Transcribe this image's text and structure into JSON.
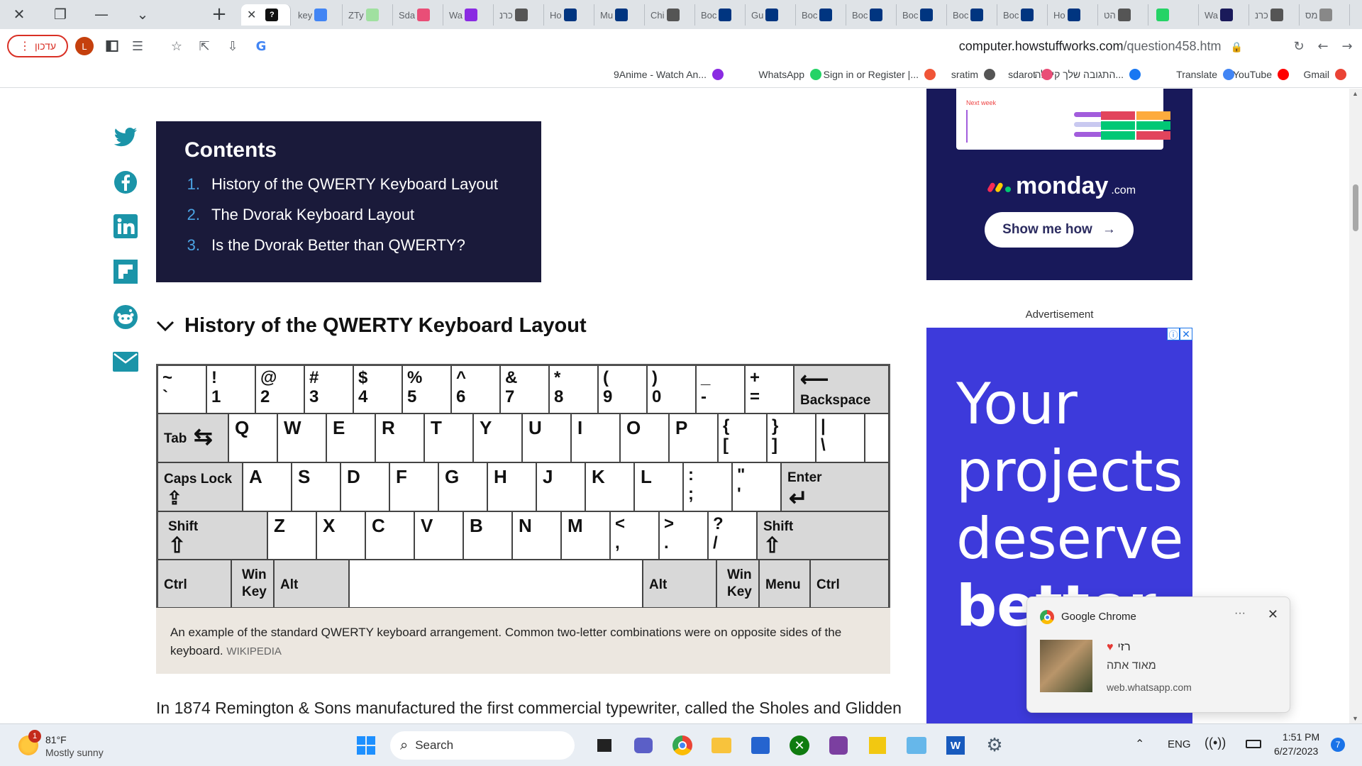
{
  "tabs": [
    {
      "label": "key",
      "icon": "docs-icon",
      "color": "#4285f4"
    },
    {
      "label": "ZTy",
      "icon": "zty-icon",
      "color": "#a0e0a0"
    },
    {
      "label": "Sda",
      "icon": "sdarot-icon",
      "color": "#e94e77"
    },
    {
      "label": "Wa",
      "icon": "play-icon",
      "color": "#8a2be2"
    },
    {
      "label": "כרנ",
      "icon": "globe-icon",
      "color": "#555555"
    },
    {
      "label": "Ho",
      "icon": "booking-icon",
      "color": "#003580"
    },
    {
      "label": "Mu",
      "icon": "booking-icon",
      "color": "#003580"
    },
    {
      "label": "Chi",
      "icon": "globe-icon",
      "color": "#555555"
    },
    {
      "label": "Boc",
      "icon": "booking-icon",
      "color": "#003580"
    },
    {
      "label": "Gu",
      "icon": "booking-icon",
      "color": "#003580"
    },
    {
      "label": "Boc",
      "icon": "booking-icon",
      "color": "#003580"
    },
    {
      "label": "Boc",
      "icon": "booking-icon",
      "color": "#003580"
    },
    {
      "label": "Boc",
      "icon": "booking-icon",
      "color": "#003580"
    },
    {
      "label": "Boc",
      "icon": "booking-icon",
      "color": "#003580"
    },
    {
      "label": "Boc",
      "icon": "booking-icon",
      "color": "#003580"
    },
    {
      "label": "Ho",
      "icon": "booking-icon",
      "color": "#003580"
    },
    {
      "label": "הט",
      "icon": "globe-icon",
      "color": "#555555"
    },
    {
      "label": "",
      "icon": "whatsapp-icon",
      "color": "#25d366"
    },
    {
      "label": "Wa",
      "icon": "tab-icon",
      "color": "#1a1a5a"
    },
    {
      "label": "כרנ",
      "icon": "globe-icon",
      "color": "#555555"
    },
    {
      "label": "מס",
      "icon": "tab-icon",
      "color": "#888888"
    }
  ],
  "toolbar": {
    "update_label": "עדכון",
    "avatar_initial": "L",
    "url_host": "computer.howstuffworks.com",
    "url_path": "/question458.htm"
  },
  "bookmarks": [
    {
      "label": "Gmail",
      "icon": "gmail-icon",
      "color": "#ea4335"
    },
    {
      "label": "YouTube",
      "icon": "youtube-icon",
      "color": "#ff0000"
    },
    {
      "label": "Translate",
      "icon": "translate-icon",
      "color": "#4285f4"
    },
    {
      "label": "התגובה שלך קיבלה...",
      "icon": "facebook-icon",
      "color": "#1877f2"
    },
    {
      "label": "sdarot",
      "icon": "sdarot-icon",
      "color": "#e94e77"
    },
    {
      "label": "sratim",
      "icon": "globe-icon",
      "color": "#555555"
    },
    {
      "label": "Sign in or Register |...",
      "icon": "eventbrite-icon",
      "color": "#f05537"
    },
    {
      "label": "WhatsApp",
      "icon": "whatsapp-icon",
      "color": "#25d366"
    },
    {
      "label": "9Anime - Watch An...",
      "icon": "play-icon",
      "color": "#8a2be2"
    }
  ],
  "contents": {
    "title": "Contents",
    "items": [
      {
        "n": "1.",
        "label": "History of the QWERTY Keyboard Layout"
      },
      {
        "n": "2.",
        "label": "The Dvorak Keyboard Layout"
      },
      {
        "n": "3.",
        "label": "Is the Dvorak Better than QWERTY?"
      }
    ]
  },
  "section_heading": "History of the QWERTY Keyboard Layout",
  "keyboard": {
    "row1": [
      [
        "~",
        "`"
      ],
      [
        "!",
        "1"
      ],
      [
        "@",
        "2"
      ],
      [
        "#",
        "3"
      ],
      [
        "$",
        "4"
      ],
      [
        "%",
        "5"
      ],
      [
        "^",
        "6"
      ],
      [
        "&",
        "7"
      ],
      [
        "*",
        "8"
      ],
      [
        "(",
        "9"
      ],
      [
        ")",
        "0"
      ],
      [
        "_",
        "-"
      ],
      [
        "+",
        "="
      ]
    ],
    "backspace": "Backspace",
    "tab": "Tab",
    "row2": [
      "Q",
      "W",
      "E",
      "R",
      "T",
      "Y",
      "U",
      "I",
      "O",
      "P"
    ],
    "row2_punct": [
      [
        "{",
        "["
      ],
      [
        "}",
        "]"
      ],
      [
        "|",
        "\\"
      ]
    ],
    "caps": "Caps Lock",
    "row3": [
      "A",
      "S",
      "D",
      "F",
      "G",
      "H",
      "J",
      "K",
      "L"
    ],
    "row3_punct": [
      [
        ":",
        ";"
      ],
      [
        "\"",
        "'"
      ]
    ],
    "enter": "Enter",
    "shift": "Shift",
    "row4": [
      "Z",
      "X",
      "C",
      "V",
      "B",
      "N",
      "M"
    ],
    "row4_punct": [
      [
        "<",
        ","
      ],
      [
        ">",
        "."
      ],
      [
        "?",
        "/"
      ]
    ],
    "ctrl": "Ctrl",
    "win_1": "Win",
    "win_2": "Key",
    "alt": "Alt",
    "menu": "Menu"
  },
  "caption": {
    "text": "An example of the standard QWERTY keyboard arrangement. Common two-letter combinations were on opposite sides of the keyboard.",
    "credit": "WIKIPEDIA"
  },
  "body_text": "In 1874 Remington & Sons manufactured the first commercial typewriter, called the Sholes and Glidden",
  "ad1": {
    "next_week": "Next week",
    "brand": "monday",
    "brand_suffix": ".com",
    "cta": "Show me how"
  },
  "ad_label": "Advertisement",
  "ad2": {
    "lines": [
      "Your",
      "projects",
      "deserve",
      "better"
    ]
  },
  "toast": {
    "app": "Google Chrome",
    "sender": "רזי",
    "message": "מאוד אתה",
    "source": "web.whatsapp.com"
  },
  "taskbar": {
    "weather_temp": "81°F",
    "weather_desc": "Mostly sunny",
    "weather_badge": "1",
    "search_label": "Search",
    "lang": "ENG",
    "time": "1:51 PM",
    "date": "6/27/2023",
    "notif_count": "7"
  }
}
